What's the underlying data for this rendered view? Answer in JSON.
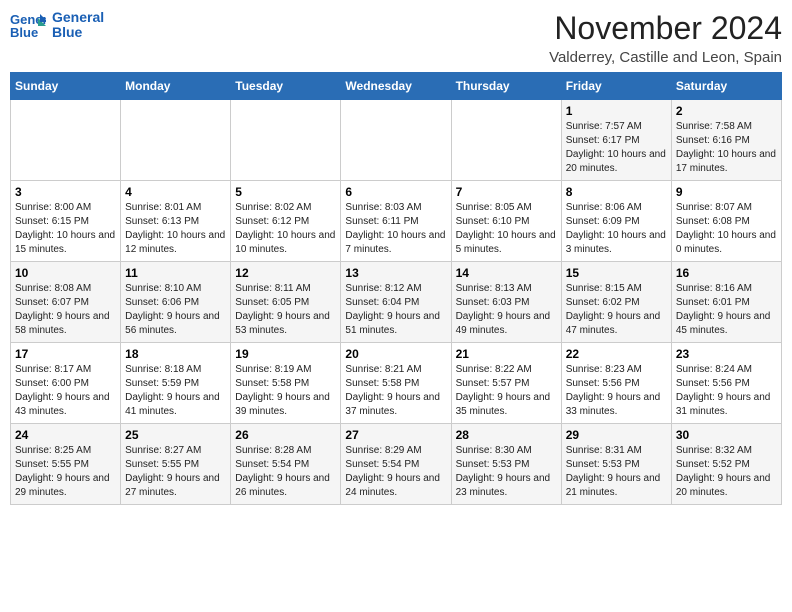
{
  "header": {
    "logo_line1": "General",
    "logo_line2": "Blue",
    "month": "November 2024",
    "location": "Valderrey, Castille and Leon, Spain"
  },
  "columns": [
    "Sunday",
    "Monday",
    "Tuesday",
    "Wednesday",
    "Thursday",
    "Friday",
    "Saturday"
  ],
  "weeks": [
    [
      {
        "day": "",
        "info": ""
      },
      {
        "day": "",
        "info": ""
      },
      {
        "day": "",
        "info": ""
      },
      {
        "day": "",
        "info": ""
      },
      {
        "day": "",
        "info": ""
      },
      {
        "day": "1",
        "info": "Sunrise: 7:57 AM\nSunset: 6:17 PM\nDaylight: 10 hours and 20 minutes."
      },
      {
        "day": "2",
        "info": "Sunrise: 7:58 AM\nSunset: 6:16 PM\nDaylight: 10 hours and 17 minutes."
      }
    ],
    [
      {
        "day": "3",
        "info": "Sunrise: 8:00 AM\nSunset: 6:15 PM\nDaylight: 10 hours and 15 minutes."
      },
      {
        "day": "4",
        "info": "Sunrise: 8:01 AM\nSunset: 6:13 PM\nDaylight: 10 hours and 12 minutes."
      },
      {
        "day": "5",
        "info": "Sunrise: 8:02 AM\nSunset: 6:12 PM\nDaylight: 10 hours and 10 minutes."
      },
      {
        "day": "6",
        "info": "Sunrise: 8:03 AM\nSunset: 6:11 PM\nDaylight: 10 hours and 7 minutes."
      },
      {
        "day": "7",
        "info": "Sunrise: 8:05 AM\nSunset: 6:10 PM\nDaylight: 10 hours and 5 minutes."
      },
      {
        "day": "8",
        "info": "Sunrise: 8:06 AM\nSunset: 6:09 PM\nDaylight: 10 hours and 3 minutes."
      },
      {
        "day": "9",
        "info": "Sunrise: 8:07 AM\nSunset: 6:08 PM\nDaylight: 10 hours and 0 minutes."
      }
    ],
    [
      {
        "day": "10",
        "info": "Sunrise: 8:08 AM\nSunset: 6:07 PM\nDaylight: 9 hours and 58 minutes."
      },
      {
        "day": "11",
        "info": "Sunrise: 8:10 AM\nSunset: 6:06 PM\nDaylight: 9 hours and 56 minutes."
      },
      {
        "day": "12",
        "info": "Sunrise: 8:11 AM\nSunset: 6:05 PM\nDaylight: 9 hours and 53 minutes."
      },
      {
        "day": "13",
        "info": "Sunrise: 8:12 AM\nSunset: 6:04 PM\nDaylight: 9 hours and 51 minutes."
      },
      {
        "day": "14",
        "info": "Sunrise: 8:13 AM\nSunset: 6:03 PM\nDaylight: 9 hours and 49 minutes."
      },
      {
        "day": "15",
        "info": "Sunrise: 8:15 AM\nSunset: 6:02 PM\nDaylight: 9 hours and 47 minutes."
      },
      {
        "day": "16",
        "info": "Sunrise: 8:16 AM\nSunset: 6:01 PM\nDaylight: 9 hours and 45 minutes."
      }
    ],
    [
      {
        "day": "17",
        "info": "Sunrise: 8:17 AM\nSunset: 6:00 PM\nDaylight: 9 hours and 43 minutes."
      },
      {
        "day": "18",
        "info": "Sunrise: 8:18 AM\nSunset: 5:59 PM\nDaylight: 9 hours and 41 minutes."
      },
      {
        "day": "19",
        "info": "Sunrise: 8:19 AM\nSunset: 5:58 PM\nDaylight: 9 hours and 39 minutes."
      },
      {
        "day": "20",
        "info": "Sunrise: 8:21 AM\nSunset: 5:58 PM\nDaylight: 9 hours and 37 minutes."
      },
      {
        "day": "21",
        "info": "Sunrise: 8:22 AM\nSunset: 5:57 PM\nDaylight: 9 hours and 35 minutes."
      },
      {
        "day": "22",
        "info": "Sunrise: 8:23 AM\nSunset: 5:56 PM\nDaylight: 9 hours and 33 minutes."
      },
      {
        "day": "23",
        "info": "Sunrise: 8:24 AM\nSunset: 5:56 PM\nDaylight: 9 hours and 31 minutes."
      }
    ],
    [
      {
        "day": "24",
        "info": "Sunrise: 8:25 AM\nSunset: 5:55 PM\nDaylight: 9 hours and 29 minutes."
      },
      {
        "day": "25",
        "info": "Sunrise: 8:27 AM\nSunset: 5:55 PM\nDaylight: 9 hours and 27 minutes."
      },
      {
        "day": "26",
        "info": "Sunrise: 8:28 AM\nSunset: 5:54 PM\nDaylight: 9 hours and 26 minutes."
      },
      {
        "day": "27",
        "info": "Sunrise: 8:29 AM\nSunset: 5:54 PM\nDaylight: 9 hours and 24 minutes."
      },
      {
        "day": "28",
        "info": "Sunrise: 8:30 AM\nSunset: 5:53 PM\nDaylight: 9 hours and 23 minutes."
      },
      {
        "day": "29",
        "info": "Sunrise: 8:31 AM\nSunset: 5:53 PM\nDaylight: 9 hours and 21 minutes."
      },
      {
        "day": "30",
        "info": "Sunrise: 8:32 AM\nSunset: 5:52 PM\nDaylight: 9 hours and 20 minutes."
      }
    ]
  ]
}
